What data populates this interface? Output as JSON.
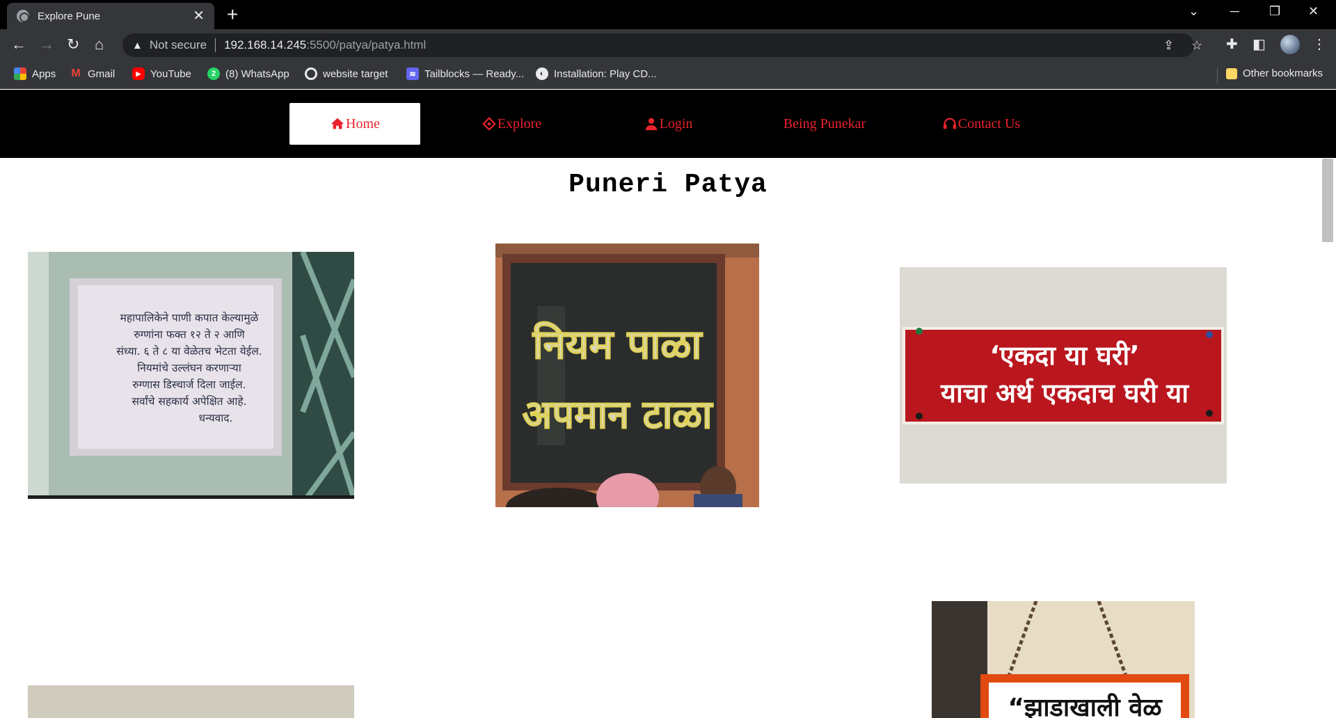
{
  "browser": {
    "tab_title": "Explore Pune",
    "security_label": "Not secure",
    "url_host": "192.168.14.245",
    "url_rest": ":5500/patya/patya.html"
  },
  "bookmarks": [
    {
      "label": "Apps",
      "icon": "apps-grid-icon"
    },
    {
      "label": "Gmail",
      "icon": "gmail-icon"
    },
    {
      "label": "YouTube",
      "icon": "youtube-icon"
    },
    {
      "label": "(8) WhatsApp",
      "icon": "whatsapp-icon"
    },
    {
      "label": "website target",
      "icon": "target-icon"
    },
    {
      "label": "Tailblocks — Ready...",
      "icon": "tailblocks-icon"
    },
    {
      "label": "Installation: Play CD...",
      "icon": "globe-icon"
    },
    {
      "label": "Other bookmarks",
      "icon": "folder-icon"
    }
  ],
  "site_nav": {
    "items": [
      {
        "label": "Home",
        "icon": "home-icon",
        "active": true
      },
      {
        "label": "Explore",
        "icon": "compass-icon",
        "active": false
      },
      {
        "label": "Login",
        "icon": "user-icon",
        "active": false
      },
      {
        "label": "Being Punekar",
        "icon": "",
        "active": false
      },
      {
        "label": "Contact Us",
        "icon": "headset-icon",
        "active": false
      }
    ],
    "accent_color": "#e8232b"
  },
  "page": {
    "title": "Puneri Patya"
  },
  "signs": {
    "sign1": [
      "महापालिकेने पाणी कपात केल्यामुळे",
      "रुग्णांना फक्त १२ ते २ आणि",
      "संध्या. ६ ते ८ या वेळेतच भेटता येईल.",
      "नियमांचे उल्लंघन करणाऱ्या",
      "रुग्णास डिस्चार्ज दिला जाईल.",
      "सर्वांचे सहकार्य अपेक्षित आहे.",
      "धन्यवाद."
    ],
    "sign2": [
      "नियम पाळा",
      "अपमान टाळा"
    ],
    "sign3": [
      "‘एकदा या घरी’",
      "याचा अर्थ एकदाच घरी या"
    ],
    "sign5": [
      "“झाडाखाली वेळ"
    ]
  }
}
